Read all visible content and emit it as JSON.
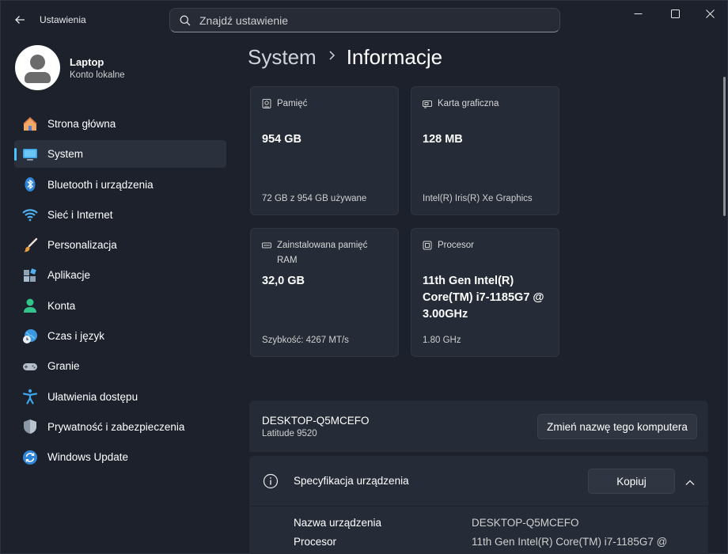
{
  "window": {
    "title": "Ustawienia",
    "search_placeholder": "Znajdź ustawienie"
  },
  "profile": {
    "name": "Laptop",
    "account_type": "Konto lokalne"
  },
  "sidebar": {
    "items": [
      {
        "label": "Strona główna",
        "icon": "home-icon",
        "active": false
      },
      {
        "label": "System",
        "icon": "system-monitor-icon",
        "active": true
      },
      {
        "label": "Bluetooth i urządzenia",
        "icon": "bluetooth-icon",
        "active": false
      },
      {
        "label": "Sieć i Internet",
        "icon": "wifi-icon",
        "active": false
      },
      {
        "label": "Personalizacja",
        "icon": "brush-icon",
        "active": false
      },
      {
        "label": "Aplikacje",
        "icon": "apps-icon",
        "active": false
      },
      {
        "label": "Konta",
        "icon": "account-icon",
        "active": false
      },
      {
        "label": "Czas i język",
        "icon": "globe-clock-icon",
        "active": false
      },
      {
        "label": "Granie",
        "icon": "gamepad-icon",
        "active": false
      },
      {
        "label": "Ułatwienia dostępu",
        "icon": "accessibility-icon",
        "active": false
      },
      {
        "label": "Prywatność i zabezpieczenia",
        "icon": "shield-icon",
        "active": false
      },
      {
        "label": "Windows Update",
        "icon": "update-icon",
        "active": false
      }
    ]
  },
  "breadcrumb": {
    "parent": "System",
    "current": "Informacje"
  },
  "cards": {
    "storage": {
      "title": "Pamięć",
      "value": "954 GB",
      "sub": "72 GB z 954 GB używane",
      "icon": "storage-icon"
    },
    "gpu": {
      "title": "Karta graficzna",
      "value": "128 MB",
      "sub": "Intel(R) Iris(R) Xe Graphics",
      "icon": "gpu-icon"
    },
    "ram": {
      "title": "Zainstalowana pamięć RAM",
      "value": "32,0 GB",
      "sub": "Szybkość: 4267 MT/s",
      "icon": "ram-icon"
    },
    "cpu": {
      "title": "Procesor",
      "value": "11th Gen Intel(R) Core(TM) i7-1185G7 @ 3.00GHz",
      "sub": "1.80 GHz",
      "icon": "cpu-icon"
    }
  },
  "device": {
    "name": "DESKTOP-Q5MCEFO",
    "model": "Latitude 9520",
    "rename_button": "Zmień nazwę tego komputera"
  },
  "specs": {
    "title": "Specyfikacja urządzenia",
    "copy_button": "Kopiuj",
    "rows": [
      {
        "label": "Nazwa urządzenia",
        "value": "DESKTOP-Q5MCEFO"
      },
      {
        "label": "Procesor",
        "value": "11th Gen Intel(R) Core(TM) i7-1185G7 @"
      }
    ]
  },
  "colors": {
    "accent": "#4cc2ff",
    "background": "#1c212c",
    "card": "#262c37"
  }
}
